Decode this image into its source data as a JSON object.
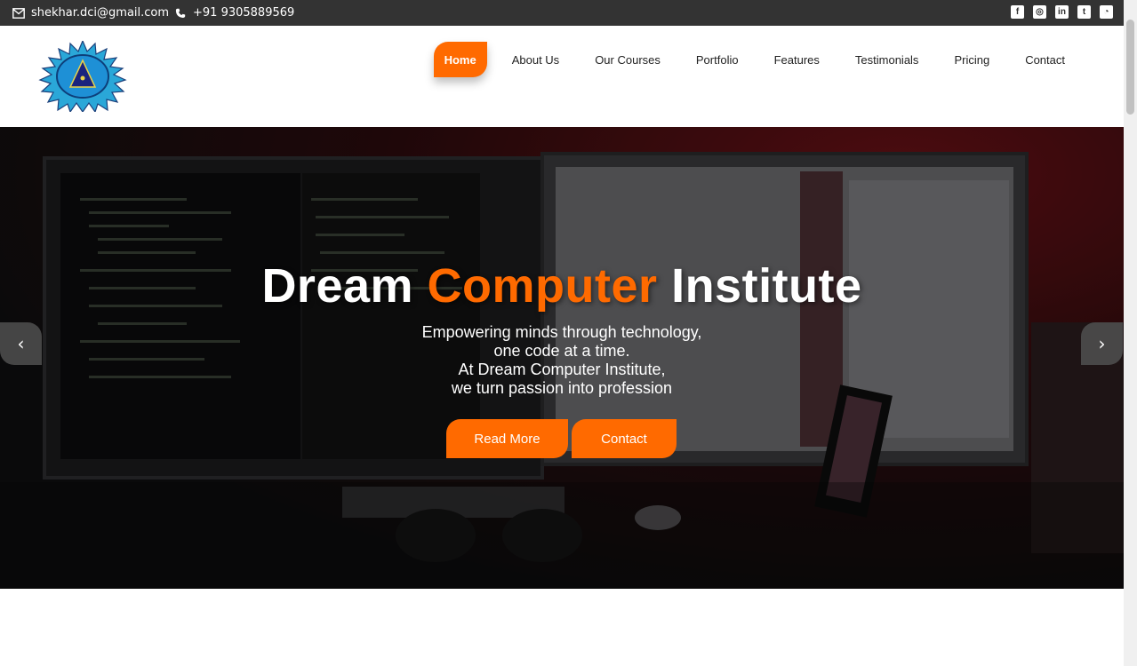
{
  "topbar": {
    "email": "shekhar.dci@gmail.com",
    "phone": "+91 9305889569",
    "email_icon": "envelope-icon",
    "phone_icon": "phone-icon",
    "socials": [
      {
        "name": "facebook-icon",
        "glyph": "f"
      },
      {
        "name": "instagram-icon",
        "glyph": "◎"
      },
      {
        "name": "linkedin-icon",
        "glyph": "in"
      },
      {
        "name": "twitter-icon",
        "glyph": "t"
      },
      {
        "name": "rss-icon",
        "glyph": "◔"
      }
    ]
  },
  "nav": {
    "items": [
      {
        "label": "Home",
        "active": true
      },
      {
        "label": "About Us"
      },
      {
        "label": "Our Courses"
      },
      {
        "label": "Portfolio"
      },
      {
        "label": "Features"
      },
      {
        "label": "Testimonials"
      },
      {
        "label": "Pricing"
      },
      {
        "label": "Contact"
      }
    ]
  },
  "hero": {
    "title_part1": "Dream",
    "title_accent": "Computer",
    "title_part2": "Institute",
    "subtitle_lines": [
      "Empowering minds through technology,",
      "one code at a time.",
      "At Dream Computer Institute,",
      "we turn passion into profession"
    ],
    "read_more_label": "Read More",
    "contact_label": "Contact",
    "prev_icon": "‹",
    "next_icon": "›"
  },
  "colors": {
    "accent": "#ff6a00",
    "topbar": "#333333"
  }
}
